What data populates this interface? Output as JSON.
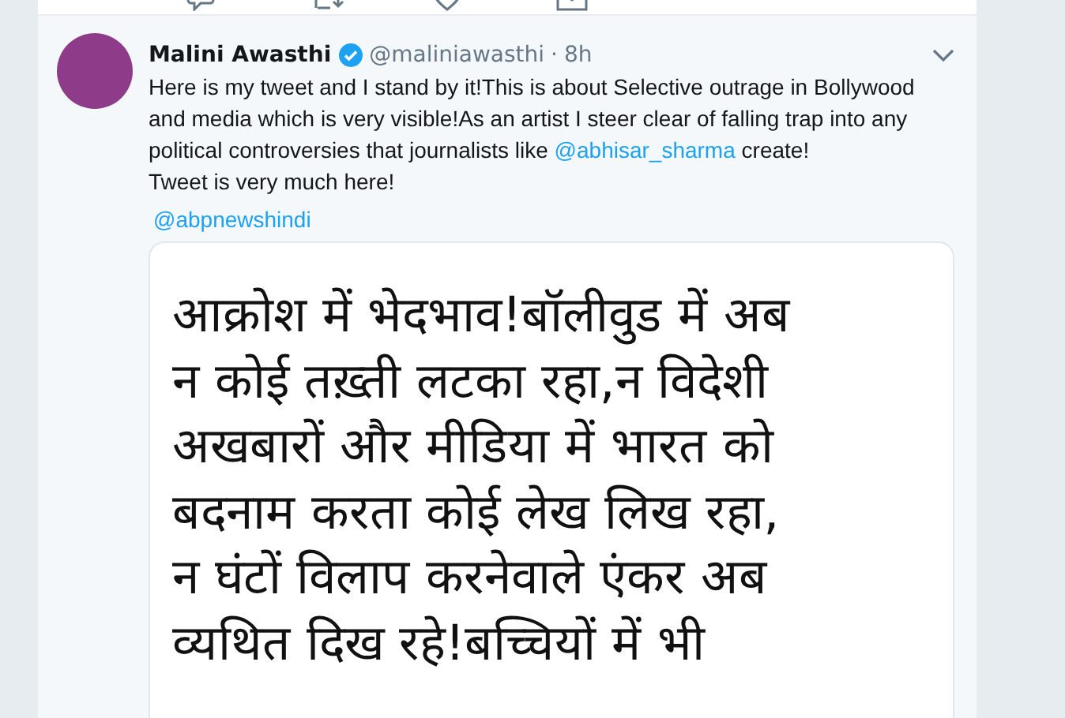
{
  "previous_tweet_actions": [
    {
      "kind": "reply"
    },
    {
      "kind": "retweet"
    },
    {
      "kind": "like"
    },
    {
      "kind": "message"
    }
  ],
  "tweet": {
    "name": "Malini Awasthi",
    "verified": true,
    "handle": "@maliniawasthi",
    "separator": "·",
    "time": "8h",
    "text": [
      "Here is my tweet and I stand by it!This is about Selective outrage in Bollywood and media which is very visible!As an artist I steer clear of falling trap into any political controversies that journalists like ",
      {
        "mention": "@abhisar_sharma"
      },
      " create!"
    ],
    "text_line_2": "Tweet is very much here!",
    "quoted_mention": "@abpnewshindi",
    "image_text_lines": [
      "आक्रोश में भेदभाव!बॉलीवुड में अब",
      "न कोई तख़्ती लटका रहा,न विदेशी",
      "अखबारों और मीडिया में भारत को",
      "बदनाम करता कोई लेख लिख रहा,",
      "न घंटों विलाप करनेवाले एंकर अब",
      "व्यथित दिख रहे!बच्चियों में भी"
    ]
  }
}
